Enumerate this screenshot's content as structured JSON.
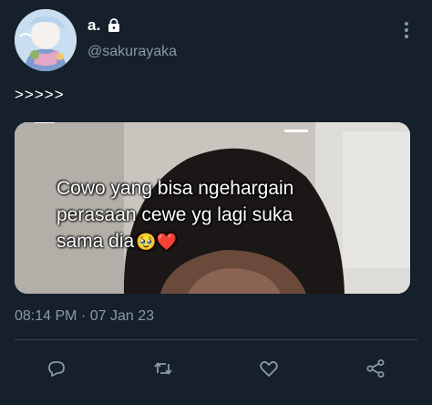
{
  "tweet": {
    "display_name": "a.",
    "handle": "@sakurayaka",
    "text": ">>>>>",
    "timestamp": "08:14 PM · 07 Jan 23",
    "media": {
      "caption_lines": [
        "Cowo yang bisa ngehargain",
        "perasaan cewe yg lagi suka",
        "sama dia"
      ],
      "caption_emojis": "🥹❤️"
    }
  },
  "icons": {
    "lock": "lock-icon",
    "more": "more-vertical-icon",
    "reply": "reply-icon",
    "retweet": "retweet-icon",
    "like": "heart-icon",
    "share": "share-icon"
  },
  "colors": {
    "background": "#15202b",
    "secondary_text": "#8b98a5",
    "divider": "#38444d"
  }
}
